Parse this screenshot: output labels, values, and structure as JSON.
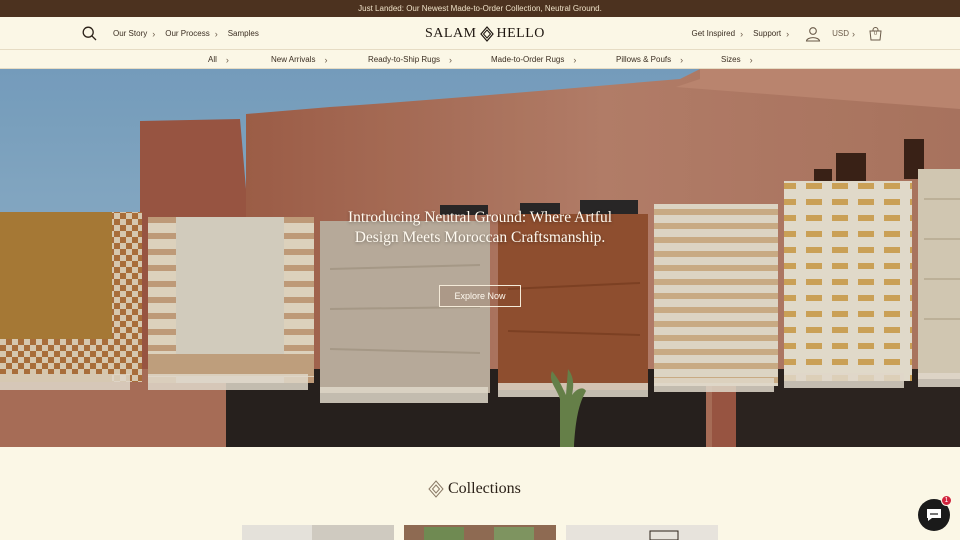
{
  "announcement": "Just Landed: Our Newest Made-to-Order Collection, Neutral Ground.",
  "header": {
    "left_links": [
      {
        "label": "Our Story"
      },
      {
        "label": "Our Process"
      },
      {
        "label": "Samples"
      }
    ],
    "logo_left": "SALAM",
    "logo_right": "HELLO",
    "right_links": [
      {
        "label": "Get Inspired"
      },
      {
        "label": "Support"
      }
    ],
    "currency": "USD",
    "cart_count": "0"
  },
  "category_nav": [
    {
      "label": "All"
    },
    {
      "label": "New Arrivals"
    },
    {
      "label": "Ready-to-Ship Rugs"
    },
    {
      "label": "Made-to-Order Rugs"
    },
    {
      "label": "Pillows & Poufs"
    },
    {
      "label": "Sizes"
    }
  ],
  "hero": {
    "title": "Introducing Neutral Ground: Where Artful Design Meets Moroccan Craftsmanship.",
    "cta": "Explore Now"
  },
  "collections": {
    "title": "Collections"
  },
  "chat": {
    "badge": "1"
  },
  "icons": [
    "search-icon",
    "chevron-right-icon",
    "logo-diamond-icon",
    "account-icon",
    "chevron-right-icon",
    "cart-icon",
    "chat-icon"
  ],
  "colors": {
    "announcement_bg": "#4c321f",
    "page_bg": "#fbf7e6",
    "sky": "#8fb3cf",
    "wall": "#b97a62",
    "chat_bg": "#1a1a1a",
    "badge": "#d1243d"
  }
}
